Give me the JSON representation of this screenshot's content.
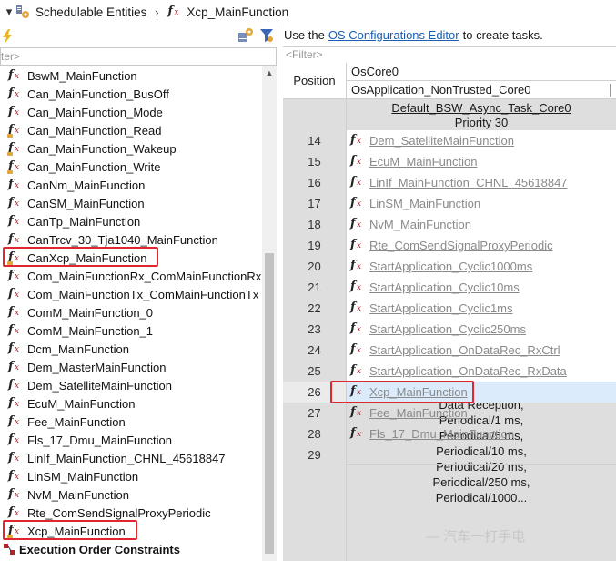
{
  "breadcrumb": {
    "root": "Schedulable Entities",
    "current": "Xcp_MainFunction"
  },
  "left": {
    "filter_placeholder": "ter>",
    "items": [
      "BswM_MainFunction",
      "Can_MainFunction_BusOff",
      "Can_MainFunction_Mode",
      "Can_MainFunction_Read",
      "Can_MainFunction_Wakeup",
      "Can_MainFunction_Write",
      "CanNm_MainFunction",
      "CanSM_MainFunction",
      "CanTp_MainFunction",
      "CanTrcv_30_Tja1040_MainFunction",
      "CanXcp_MainFunction",
      "Com_MainFunctionRx_ComMainFunctionRx",
      "Com_MainFunctionTx_ComMainFunctionTx",
      "ComM_MainFunction_0",
      "ComM_MainFunction_1",
      "Dcm_MainFunction",
      "Dem_MasterMainFunction",
      "Dem_SatelliteMainFunction",
      "EcuM_MainFunction",
      "Fee_MainFunction",
      "Fls_17_Dmu_MainFunction",
      "LinIf_MainFunction_CHNL_45618847",
      "LinSM_MainFunction",
      "NvM_MainFunction",
      "Rte_ComSendSignalProxyPeriodic",
      "Xcp_MainFunction"
    ],
    "footer_item": "Execution Order Constraints"
  },
  "right": {
    "hint_prefix": "Use the",
    "hint_link": "OS Configurations Editor",
    "hint_suffix": "to create tasks.",
    "filter_placeholder": "<Filter>",
    "col_position": "Position",
    "core": "OsCore0",
    "application": "OsApplication_NonTrusted_Core0",
    "task_name": "Default_BSW_Async_Task_Core0",
    "task_priority": "Priority 30",
    "rows": [
      {
        "pos": "14",
        "name": "Dem_SatelliteMainFunction"
      },
      {
        "pos": "15",
        "name": "EcuM_MainFunction"
      },
      {
        "pos": "16",
        "name": "LinIf_MainFunction_CHNL_45618847"
      },
      {
        "pos": "17",
        "name": "LinSM_MainFunction"
      },
      {
        "pos": "18",
        "name": "NvM_MainFunction"
      },
      {
        "pos": "19",
        "name": "Rte_ComSendSignalProxyPeriodic"
      },
      {
        "pos": "20",
        "name": "StartApplication_Cyclic1000ms"
      },
      {
        "pos": "21",
        "name": "StartApplication_Cyclic10ms"
      },
      {
        "pos": "22",
        "name": "StartApplication_Cyclic1ms"
      },
      {
        "pos": "23",
        "name": "StartApplication_Cyclic250ms"
      },
      {
        "pos": "24",
        "name": "StartApplication_OnDataRec_RxCtrl"
      },
      {
        "pos": "25",
        "name": "StartApplication_OnDataRec_RxData"
      },
      {
        "pos": "26",
        "name": "Xcp_MainFunction"
      },
      {
        "pos": "27",
        "name": "Fee_MainFunction"
      },
      {
        "pos": "28",
        "name": "Fls_17_Dmu_MainFunction"
      },
      {
        "pos": "29",
        "name": ""
      }
    ],
    "timing": [
      "Data Reception,",
      "Periodical/1 ms,",
      "Periodical/5 ms,",
      "Periodical/10 ms,",
      "Periodical/20 ms,",
      "Periodical/250 ms,",
      "Periodical/1000..."
    ]
  },
  "watermark": "— 汽车一打手电",
  "colors": {
    "highlight": "#e0262f",
    "link": "#1a5fb4",
    "selection": "#dcebfb"
  }
}
